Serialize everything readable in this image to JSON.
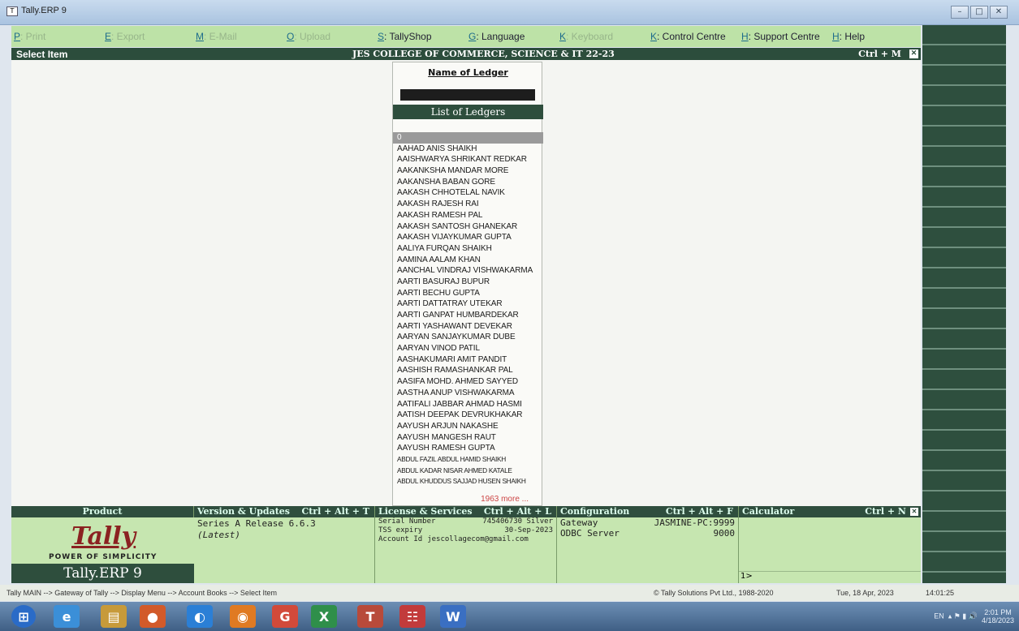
{
  "window": {
    "title": "Tally.ERP 9",
    "icon": "tally-app-icon",
    "controls": [
      "minimize",
      "maximize",
      "close"
    ]
  },
  "menu": [
    {
      "key": "P",
      "label": ": Print",
      "enabled": false
    },
    {
      "key": "E",
      "label": ": Export",
      "enabled": false
    },
    {
      "key": "M",
      "label": ": E-Mail",
      "enabled": false
    },
    {
      "key": "O",
      "label": ": Upload",
      "enabled": false
    },
    {
      "key": "S",
      "label": ": TallyShop",
      "enabled": true
    },
    {
      "key": "G",
      "label": ": Language",
      "enabled": true
    },
    {
      "key": "K",
      "label": ": Keyboard",
      "enabled": false
    },
    {
      "key": "K",
      "label": ": Control Centre",
      "enabled": true
    },
    {
      "key": "H",
      "label": ": Support Centre",
      "enabled": true
    },
    {
      "key": "H",
      "label": ": Help",
      "enabled": true
    }
  ],
  "header": {
    "screen": "Select Item",
    "company": "JES COLLEGE OF COMMERCE, SCIENCE & IT 22-23",
    "shortcut": "Ctrl + M"
  },
  "popup": {
    "title": "Name of Ledger",
    "list_header": "List of Ledgers",
    "items": [
      "0",
      "AAHAD ANIS SHAIKH",
      "AAISHWARYA SHRIKANT REDKAR",
      "AAKANKSHA MANDAR MORE",
      "AAKANSHA BABAN GORE",
      "AAKASH CHHOTELAL NAVIK",
      "AAKASH RAJESH RAI",
      "AAKASH RAMESH PAL",
      "AAKASH SANTOSH GHANEKAR",
      "AAKASH VIJAYKUMAR GUPTA",
      "AALIYA FURQAN SHAIKH",
      "AAMINA AALAM KHAN",
      "AANCHAL VINDRAJ VISHWAKARMA",
      "AARTI BASURAJ BUPUR",
      "AARTI BECHU GUPTA",
      "AARTI DATTATRAY UTEKAR",
      "AARTI GANPAT HUMBARDEKAR",
      "AARTI YASHAWANT DEVEKAR",
      "AARYAN SANJAYKUMAR DUBE",
      "AARYAN VINOD PATIL",
      "AASHAKUMARI AMIT PANDIT",
      "AASHISH RAMASHANKAR PAL",
      "AASIFA MOHD. AHMED SAYYED",
      "AASTHA ANUP VISHWAKARMA",
      "AATIFALI JABBAR AHMAD HASMI",
      "AATISH DEEPAK DEVRUKHAKAR",
      "AAYUSH ARJUN NAKASHE",
      "AAYUSH MANGESH RAUT",
      "AAYUSH RAMESH GUPTA",
      "ABDUL FAZIL ABDUL HAMID SHAIKH",
      "ABDUL KADAR NISAR AHMED KATALE",
      "ABDUL KHUDDUS SAJJAD HUSEN SHAIKH"
    ],
    "more": "1963 more ..."
  },
  "bottom": {
    "product": {
      "header": "Product",
      "logo": "Tally",
      "tagline": "POWER OF SIMPLICITY",
      "name": "Tally.ERP 9"
    },
    "version": {
      "header": "Version & Updates",
      "shortcut": "Ctrl + Alt + T",
      "release": "Series A Release 6.6.3",
      "status": "(Latest)"
    },
    "license": {
      "header": "License & Services",
      "shortcut": "Ctrl + Alt + L",
      "serial_label": "Serial Number",
      "serial_value": "745406730 Silver",
      "tss_label": "TSS expiry",
      "tss_value": "30-Sep-2023",
      "account_label": "Account Id",
      "account_value": "jescollagecom@gmail.com"
    },
    "config": {
      "header": "Configuration",
      "shortcut": "Ctrl + Alt + F",
      "gateway_label": "Gateway",
      "gateway_value": "JASMINE-PC:9999",
      "odbc_label": "ODBC Server",
      "odbc_value": "9000"
    },
    "calculator": {
      "header": "Calculator",
      "shortcut": "Ctrl + N",
      "prompt": "1>"
    }
  },
  "status": {
    "breadcrumb": "Tally MAIN --> Gateway of Tally --> Display Menu --> Account Books --> Select Item",
    "copyright": "© Tally Solutions Pvt Ltd., 1988-2020",
    "date": "Tue, 18 Apr, 2023",
    "time": "14:01:25"
  },
  "taskbar": {
    "apps": [
      "start-orb-icon",
      "internet-explorer-icon",
      "file-explorer-icon",
      "media-player-icon",
      "chrome-icon",
      "firefox-icon",
      "google-icon",
      "excel-icon",
      "tally-taskbar-icon",
      "notepad-icon",
      "word-icon"
    ],
    "tray_lang": "EN",
    "tray_time": "2:01 PM",
    "tray_date": "4/18/2023"
  }
}
